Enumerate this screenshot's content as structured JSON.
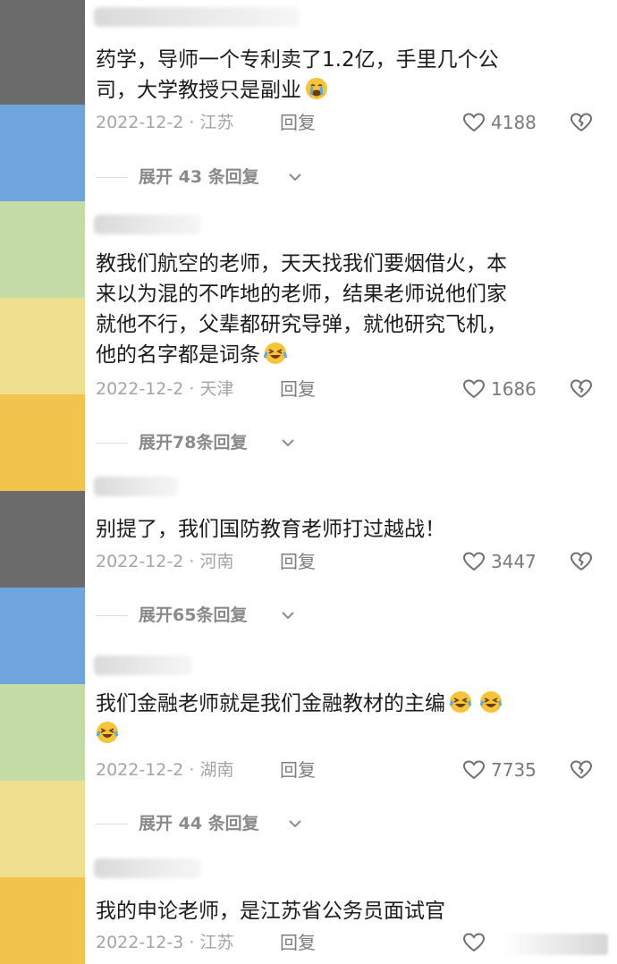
{
  "stripe_colors": [
    "#6c6c6c",
    "#6fa5dd",
    "#c6dca6",
    "#f0df8f",
    "#f2c44e",
    "#6c6c6c",
    "#6fa5dd",
    "#c6dca6",
    "#f0df8f",
    "#f2c44e"
  ],
  "reply_label": "回复",
  "comments": [
    {
      "lines": [
        "药学，导师一个专利卖了1.2亿，手里几个公",
        "司，大学教授只是副业"
      ],
      "emoji_line": 1,
      "emojis": [
        "crying-face"
      ],
      "date_location": "2022-12-2 · 江苏",
      "likes": "4188",
      "expand": "展开 43 条回复"
    },
    {
      "lines": [
        "教我们航空的老师，天天找我们要烟借火，本",
        "来以为混的不咋地的老师，结果老师说他们家",
        "就他不行，父辈都研究导弹，就他研究飞机，",
        "他的名字都是词条"
      ],
      "emoji_line": 3,
      "emojis": [
        "rolling-laughing-face"
      ],
      "date_location": "2022-12-2 · 天津",
      "likes": "1686",
      "expand": "展开78条回复"
    },
    {
      "lines": [
        "别提了，我们国防教育老师打过越战！"
      ],
      "emoji_line": -1,
      "emojis": [],
      "date_location": "2022-12-2 · 河南",
      "likes": "3447",
      "expand": "展开65条回复"
    },
    {
      "lines": [
        "我们金融老师就是我们金融教材的主编",
        ""
      ],
      "emoji_line": 0,
      "emojis": [
        "laughing-tears-face",
        "laughing-tears-face"
      ],
      "extra_emoji_line": 1,
      "extra_emojis": [
        "laughing-tears-face"
      ],
      "date_location": "2022-12-2 · 湖南",
      "likes": "7735",
      "expand": "展开 44 条回复"
    },
    {
      "lines": [
        "我的申论老师，是江苏省公务员面试官"
      ],
      "emoji_line": -1,
      "emojis": [],
      "date_location": "2022-12-3 · 江苏",
      "likes": "",
      "expand": ""
    }
  ]
}
